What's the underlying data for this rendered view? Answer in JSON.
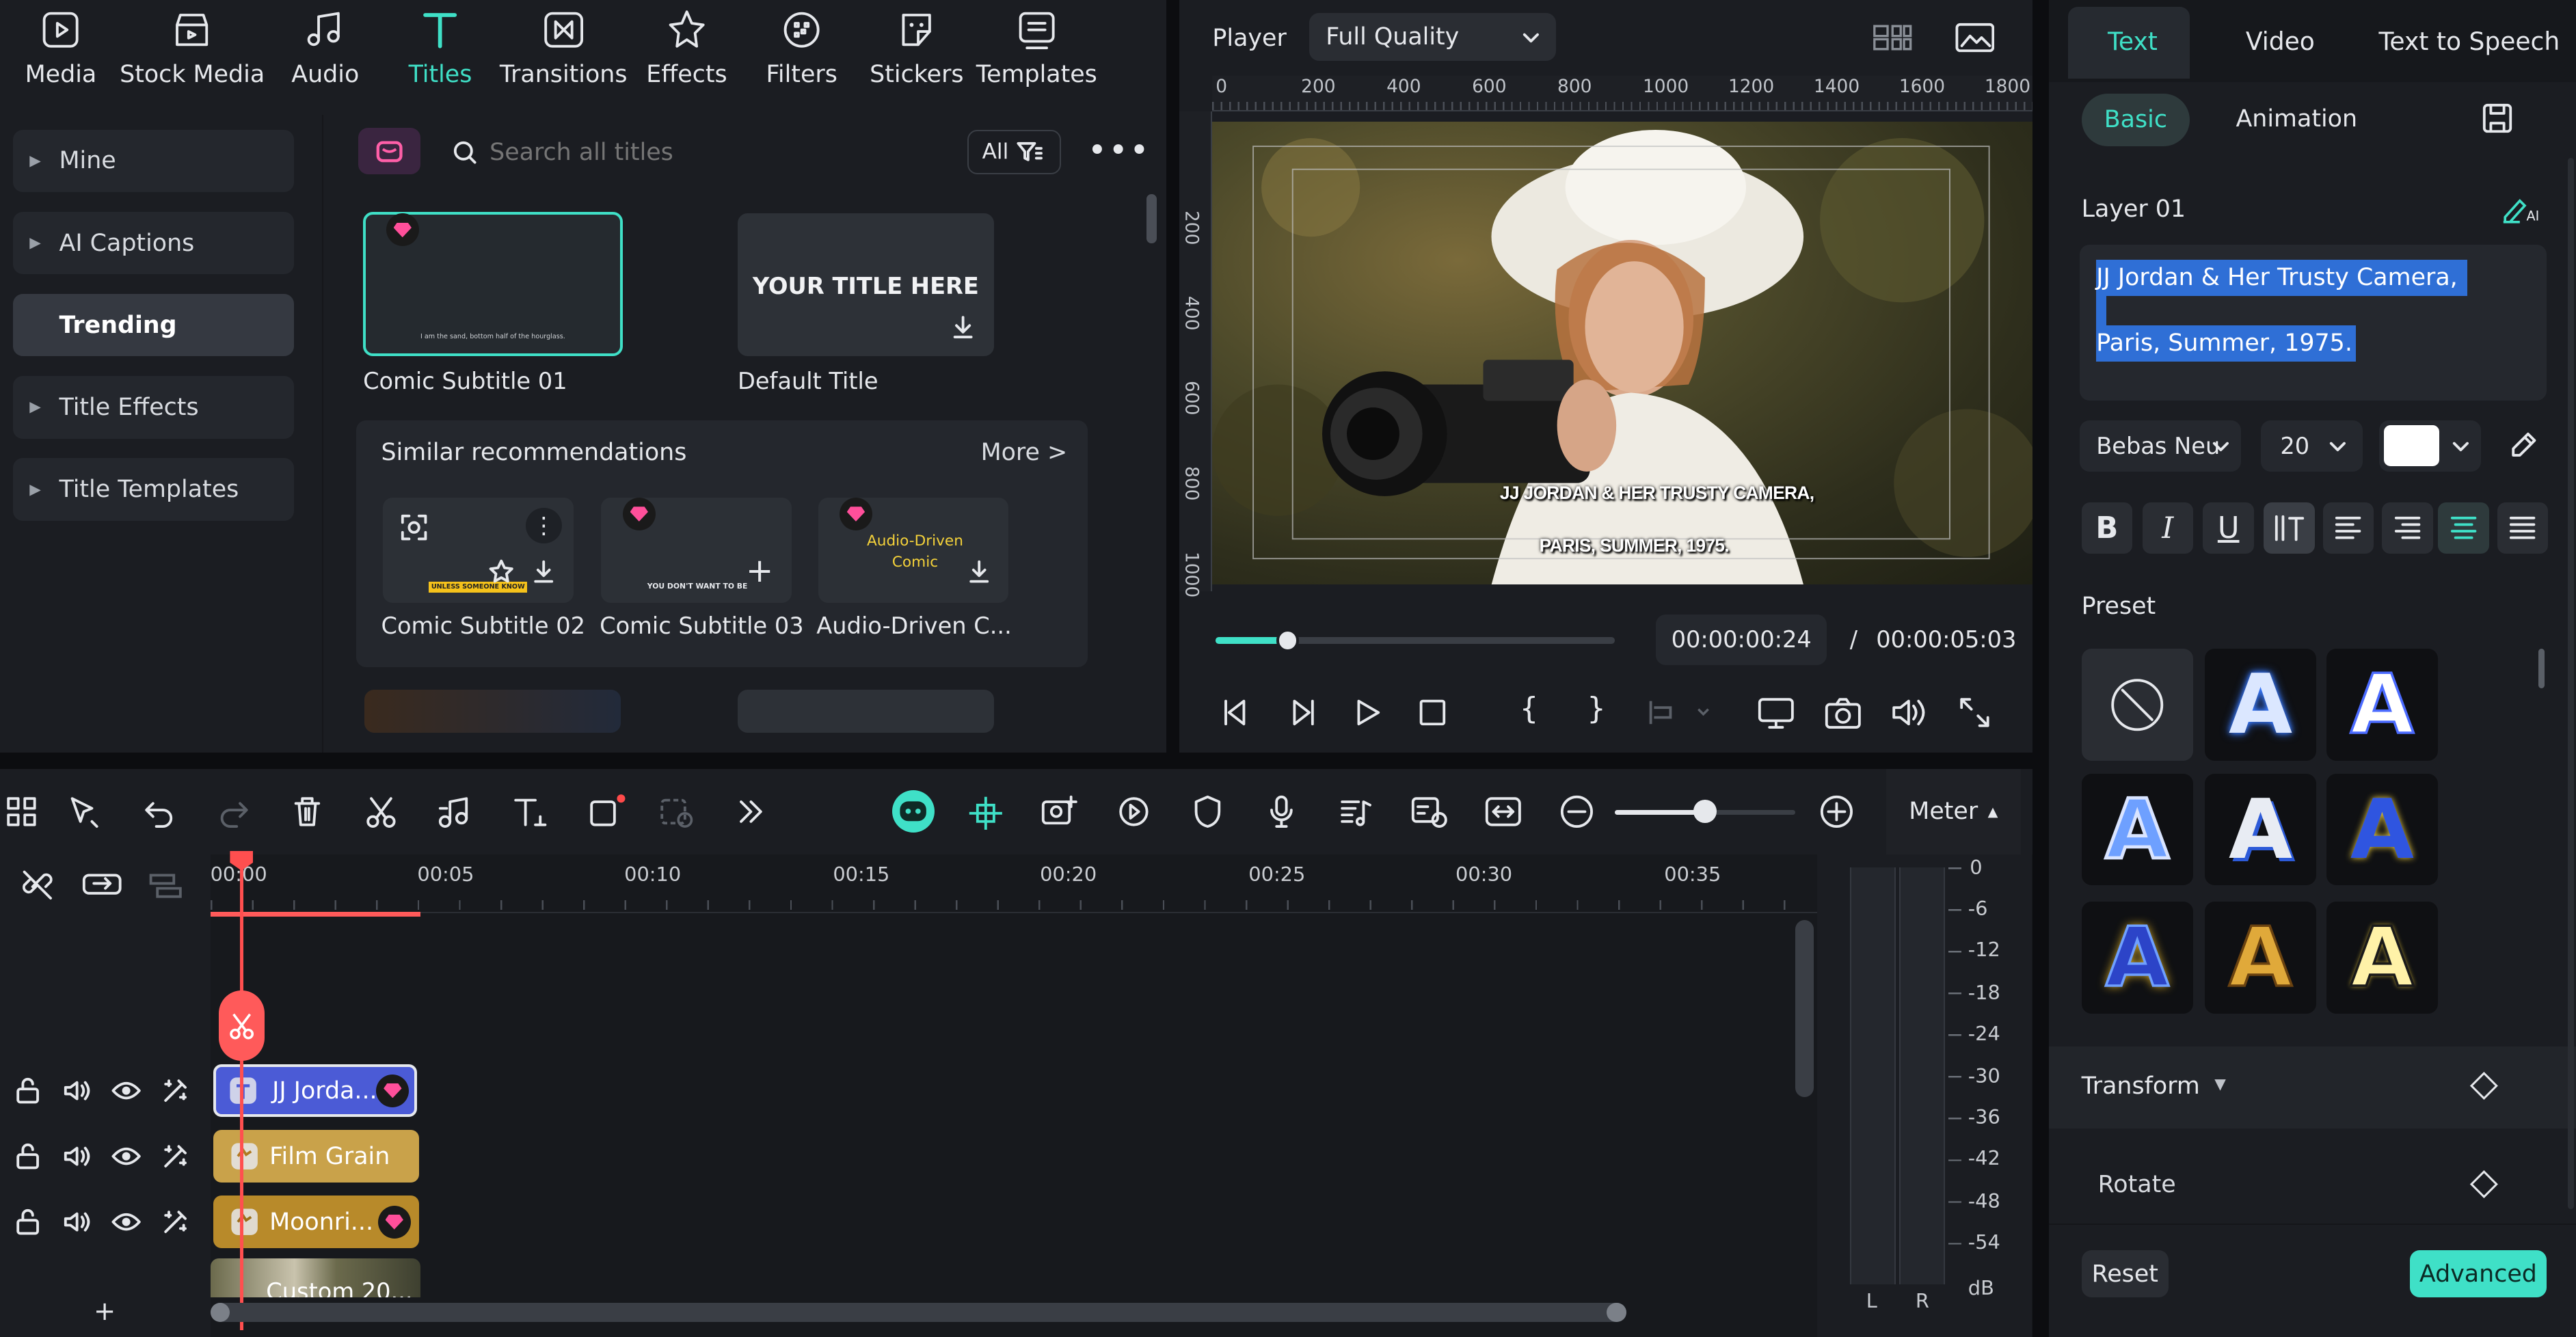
{
  "toolbar": {
    "items": [
      {
        "label": "Media",
        "icon": "media-icon"
      },
      {
        "label": "Stock Media",
        "icon": "stock-media-icon"
      },
      {
        "label": "Audio",
        "icon": "audio-icon"
      },
      {
        "label": "Titles",
        "icon": "titles-icon"
      },
      {
        "label": "Transitions",
        "icon": "transitions-icon"
      },
      {
        "label": "Effects",
        "icon": "effects-icon"
      },
      {
        "label": "Filters",
        "icon": "filters-icon"
      },
      {
        "label": "Stickers",
        "icon": "stickers-icon"
      },
      {
        "label": "Templates",
        "icon": "templates-icon"
      }
    ],
    "active": "Titles"
  },
  "sidebar": {
    "items": [
      {
        "label": "Mine"
      },
      {
        "label": "AI Captions"
      },
      {
        "label": "Trending"
      },
      {
        "label": "Title Effects"
      },
      {
        "label": "Title Templates"
      }
    ]
  },
  "search": {
    "placeholder": "Search all titles",
    "filter_label": "All"
  },
  "titles": {
    "comic_subtitle_01": {
      "label": "Comic Subtitle 01",
      "preview_text": "I am the sand, bottom half of the hourglass."
    },
    "default_title": {
      "label": "Default Title",
      "preview_text": "YOUR TITLE HERE"
    }
  },
  "similar": {
    "heading": "Similar recommendations",
    "more": "More >",
    "items": [
      {
        "label": "Comic Subtitle 02",
        "preview_text": "UNLESS SOMEONE KNOW THAT"
      },
      {
        "label": "Comic Subtitle 03",
        "preview_text": "YOU DON'T WANT TO BE"
      },
      {
        "label": "Audio-Driven C...",
        "preview_text": "Audio-Driven Comic"
      }
    ]
  },
  "player": {
    "label": "Player",
    "quality": "Full Quality",
    "ruler_h": [
      "0",
      "200",
      "400",
      "600",
      "800",
      "1000",
      "1200",
      "1400",
      "1600",
      "1800"
    ],
    "ruler_v": [
      "200",
      "400",
      "600",
      "800",
      "1000"
    ],
    "subtitle_line1": "JJ JORDAN & HER TRUSTY CAMERA,",
    "subtitle_line2": "PARIS, SUMMER, 1975.",
    "current_time": "00:00:00:24",
    "separator": "/",
    "total_time": "00:00:05:03",
    "progress": 0.18
  },
  "right_panel": {
    "tabs": [
      "Text",
      "Video",
      "Text to Speech"
    ],
    "subtabs": [
      "Basic",
      "Animation"
    ],
    "layer_label": "Layer 01",
    "text_line1": "JJ Jordan & Her Trusty Camera,",
    "text_line2": "Paris, Summer, 1975.",
    "font": "Bebas Neu",
    "size": "20",
    "color": "#ffffff",
    "format_buttons": [
      "B",
      "I",
      "U"
    ],
    "preset_label": "Preset",
    "transform_label": "Transform",
    "rotate_label": "Rotate",
    "reset_label": "Reset",
    "advanced_label": "Advanced",
    "accent": "#3fe0c7"
  },
  "timeline": {
    "ticks": [
      "00:00",
      "00:05",
      "00:10",
      "00:15",
      "00:20",
      "00:25",
      "00:30",
      "00:35"
    ],
    "meter_label": "Meter",
    "meter_scale": [
      "0",
      "-6",
      "-12",
      "-18",
      "-24",
      "-30",
      "-36",
      "-42",
      "-48",
      "-54",
      "dB"
    ],
    "meter_channels": [
      "L",
      "R"
    ],
    "clips": [
      {
        "label": "JJ Jorda...",
        "color": "#4b5bd6"
      },
      {
        "label": "Film Grain",
        "color": "#c9a24a"
      },
      {
        "label": "Moonri...",
        "color": "#b88a2a"
      },
      {
        "label": "Custom 20..."
      }
    ],
    "zoom_level": 0.5,
    "add_track": "+"
  }
}
